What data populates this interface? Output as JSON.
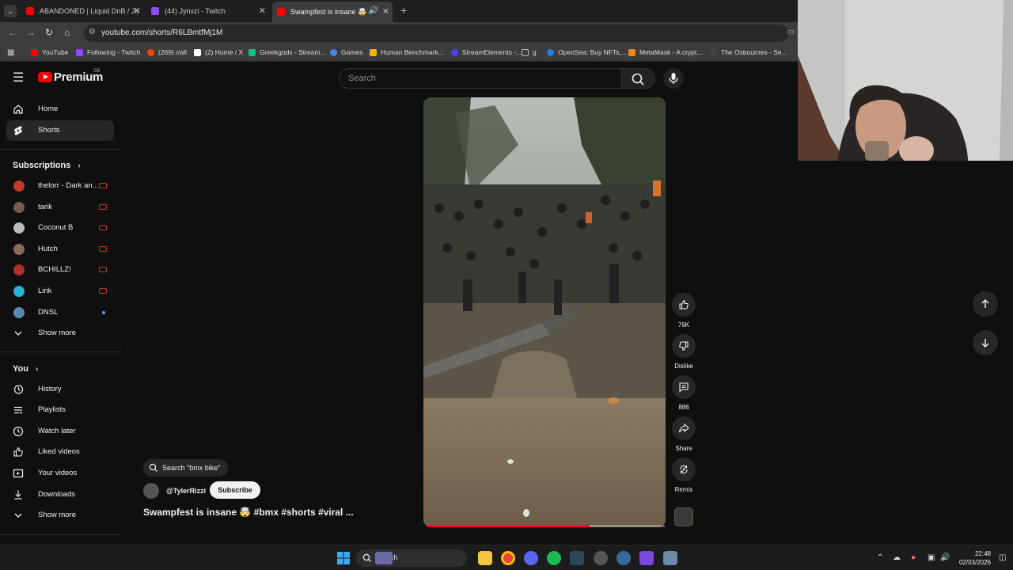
{
  "browser": {
    "tabs": [
      {
        "title": "ABANDONED | Liquid DnB / Ju",
        "color": "#ff0000",
        "active": false
      },
      {
        "title": "(44) Jynxzi - Twitch",
        "color": "#9146ff",
        "active": false
      },
      {
        "title": "Swampfest is insane 🤯 #b",
        "color": "#ff0000",
        "active": true
      }
    ],
    "url": "youtube.com/shorts/R6LBmtfMj1M",
    "bookmarks": [
      {
        "label": "YouTube",
        "color": "#ff0000"
      },
      {
        "label": "Following - Twitch",
        "color": "#9146ff"
      },
      {
        "label": "(269) r/all",
        "color": "#ff4500"
      },
      {
        "label": "(2) Home / X",
        "color": "#ffffff"
      },
      {
        "label": "Greekgodx - Stream...",
        "color": "#00c781"
      },
      {
        "label": "Games",
        "color": "#4285f4"
      },
      {
        "label": "Human Benchmark...",
        "color": "#f5b400"
      },
      {
        "label": "StreamElements -...",
        "color": "#4d41ff"
      },
      {
        "label": "g",
        "color": "#999999"
      },
      {
        "label": "OpenSea: Buy NFTs,...",
        "color": "#2081e2"
      },
      {
        "label": "MetaMask - A crypt...",
        "color": "#f6851b"
      },
      {
        "label": "The Osbournes - Se...",
        "color": "#444444"
      }
    ]
  },
  "header": {
    "logo": "Premium",
    "region": "GB",
    "search_placeholder": "Search"
  },
  "sidebar": {
    "main": [
      {
        "label": "Home",
        "icon": "home-icon"
      },
      {
        "label": "Shorts",
        "icon": "shorts-icon",
        "active": true
      }
    ],
    "subscriptions_title": "Subscriptions",
    "subscriptions": [
      {
        "label": "thelorr - Dark an...",
        "color": "#c0392b",
        "status": "live"
      },
      {
        "label": "tarik",
        "color": "#7a5a4a",
        "status": "live"
      },
      {
        "label": "Coconut B",
        "color": "#bbbbbb",
        "status": "live"
      },
      {
        "label": "Hutch",
        "color": "#8a6a5a",
        "status": "live"
      },
      {
        "label": "BCHILLZ!",
        "color": "#b03030",
        "status": "live"
      },
      {
        "label": "Lirik",
        "color": "#2bb0d8",
        "status": "live"
      },
      {
        "label": "DNSL",
        "color": "#5a8ab0",
        "status": "new"
      }
    ],
    "show_more": "Show more",
    "you_title": "You",
    "you": [
      {
        "label": "History",
        "icon": "history-icon"
      },
      {
        "label": "Playlists",
        "icon": "playlists-icon"
      },
      {
        "label": "Watch later",
        "icon": "watch-later-icon"
      },
      {
        "label": "Liked videos",
        "icon": "liked-videos-icon"
      },
      {
        "label": "Your videos",
        "icon": "your-videos-icon"
      },
      {
        "label": "Downloads",
        "icon": "downloads-icon"
      }
    ],
    "you_show_more": "Show more"
  },
  "short": {
    "suggest": "Search \"bmx bike\"",
    "channel": "@TylerRizzi",
    "subscribe": "Subscribe",
    "title": "Swampfest is insane 🤯 #bmx #shorts #viral ...",
    "progress": 0.67
  },
  "actions": {
    "likes": "76K",
    "dislike": "Dislike",
    "comments": "886",
    "share": "Share",
    "remix": "Remix"
  },
  "taskbar": {
    "search": "Search",
    "time": "22:48",
    "date": "02/03/2026"
  }
}
